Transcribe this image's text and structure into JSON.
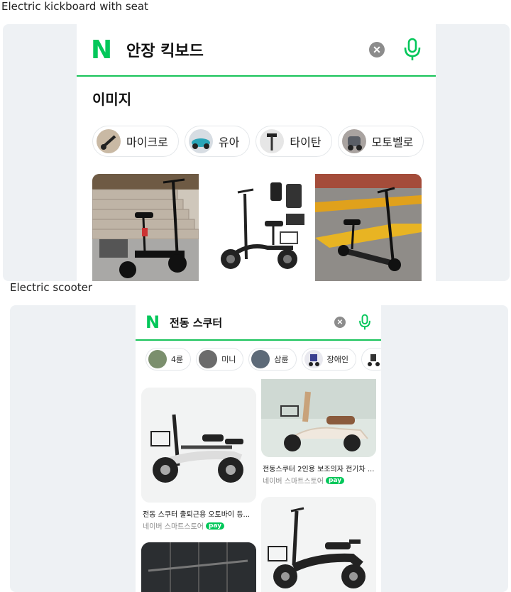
{
  "captions": {
    "top": "Electric kickboard with seat",
    "bottom": "Electric scooter"
  },
  "top_phone": {
    "logo": "N",
    "query": "안장 킥보드",
    "section_title": "이미지",
    "chips": [
      "마이크로",
      "유아",
      "타이탄",
      "모토벨로"
    ]
  },
  "bottom_phone": {
    "logo": "N",
    "query": "전동 스쿠터",
    "chips": [
      "4륜",
      "미니",
      "삼륜",
      "장애인"
    ],
    "results": [
      {
        "title": "전동스쿠터 2인용 보조의자 전기차 ...",
        "store": "네이버 스마트스토어",
        "pay": "pay"
      },
      {
        "title": "전동 스쿠터 출퇴근용 오토바이 등...",
        "store": "네이버 스마트스토어",
        "pay": "pay"
      }
    ]
  },
  "colors": {
    "naver_green": "#03c75a",
    "panel_bg": "#eef1f4"
  },
  "icons": {
    "clear": "close-circle-icon",
    "mic": "microphone-icon"
  }
}
